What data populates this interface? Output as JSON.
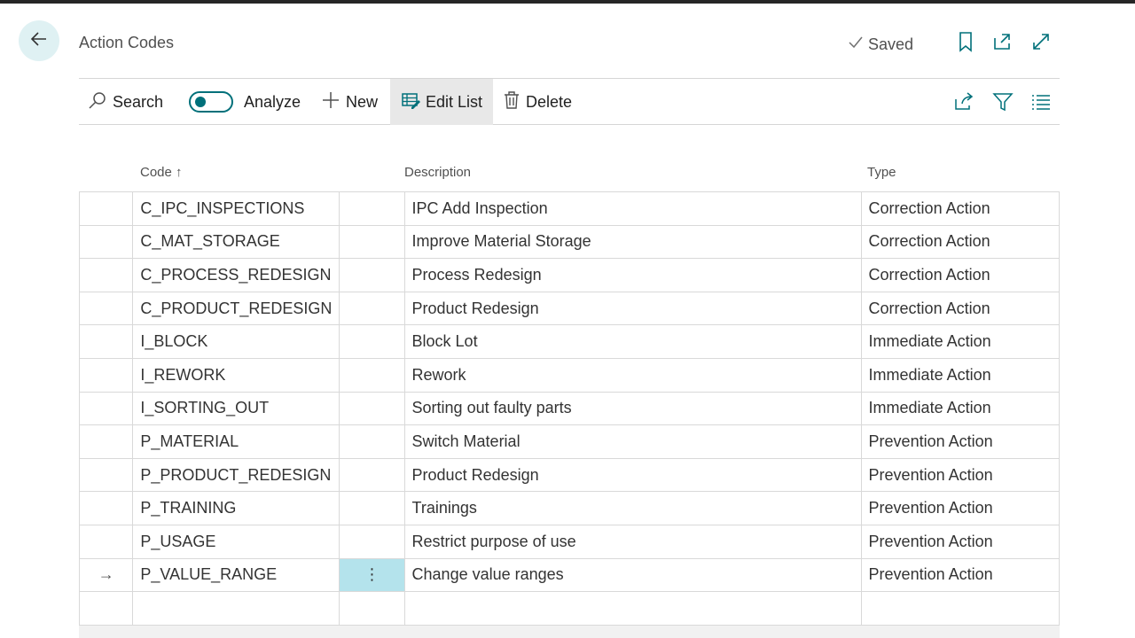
{
  "header": {
    "title": "Action Codes",
    "saved_label": "Saved"
  },
  "actions": {
    "search": "Search",
    "analyze": "Analyze",
    "new": "New",
    "edit_list": "Edit List",
    "delete": "Delete"
  },
  "columns": {
    "code": "Code",
    "code_sort_arrow": "↑",
    "description": "Description",
    "type": "Type"
  },
  "rows": [
    {
      "code": "C_IPC_INSPECTIONS",
      "description": "IPC Add Inspection",
      "type": "Correction Action"
    },
    {
      "code": "C_MAT_STORAGE",
      "description": "Improve Material Storage",
      "type": "Correction Action"
    },
    {
      "code": "C_PROCESS_REDESIGN",
      "description": "Process Redesign",
      "type": "Correction Action"
    },
    {
      "code": "C_PRODUCT_REDESIGN",
      "description": "Product Redesign",
      "type": "Correction Action"
    },
    {
      "code": "I_BLOCK",
      "description": "Block Lot",
      "type": "Immediate Action"
    },
    {
      "code": "I_REWORK",
      "description": "Rework",
      "type": "Immediate Action"
    },
    {
      "code": "I_SORTING_OUT",
      "description": "Sorting out faulty parts",
      "type": "Immediate Action"
    },
    {
      "code": "P_MATERIAL",
      "description": "Switch Material",
      "type": "Prevention Action"
    },
    {
      "code": "P_PRODUCT_REDESIGN",
      "description": "Product Redesign",
      "type": "Prevention Action"
    },
    {
      "code": "P_TRAINING",
      "description": "Trainings",
      "type": "Prevention Action"
    },
    {
      "code": "P_USAGE",
      "description": "Restrict purpose of use",
      "type": "Prevention Action"
    },
    {
      "code": "P_VALUE_RANGE",
      "description": "Change value ranges",
      "type": "Prevention Action"
    }
  ],
  "selected_row": {
    "indicator": "→",
    "menu": "⋮"
  },
  "colors": {
    "accent": "#00707a",
    "selected_cell": "#b4e3ec",
    "back_button_bg": "#dff1f3"
  },
  "icons": {
    "back": "arrow-left-icon",
    "saved": "check-icon",
    "bookmark": "bookmark-icon",
    "open_new": "open-in-new-window-icon",
    "expand": "expand-icon",
    "search": "search-icon",
    "new": "plus-icon",
    "edit_list": "edit-list-icon",
    "delete": "trash-icon",
    "share": "share-icon",
    "filter": "filter-icon",
    "list_view": "list-view-icon"
  }
}
